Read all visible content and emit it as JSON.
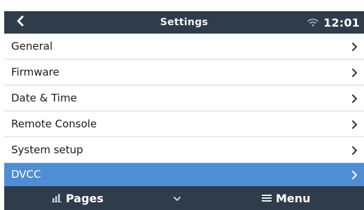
{
  "header": {
    "title": "Settings",
    "time": "12:01"
  },
  "menu": {
    "items": [
      {
        "label": "General"
      },
      {
        "label": "Firmware"
      },
      {
        "label": "Date & Time"
      },
      {
        "label": "Remote Console"
      },
      {
        "label": "System setup"
      },
      {
        "label": "DVCC"
      }
    ]
  },
  "footer": {
    "pages_label": "Pages",
    "menu_label": "Menu"
  },
  "colors": {
    "header_bg": "#2f3c4b",
    "selected_bg": "#4e8ed3",
    "divider": "#d4d7db"
  },
  "icons": {
    "back": "chevron-left-icon",
    "wifi": "wifi-icon",
    "item_arrow": "chevron-right-icon",
    "pages": "bar-chart-icon",
    "down": "chevron-down-icon",
    "menu": "hamburger-icon"
  }
}
